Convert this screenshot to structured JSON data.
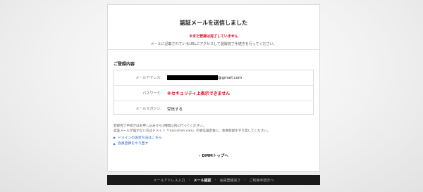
{
  "header": {
    "title": "認証メールを送信しました",
    "warning": "※まだ登録は完了していません",
    "description": "メールに記載されているURLにアクセスして登録完了手続きを行ってください。"
  },
  "registration": {
    "section_title": "ご登録内容",
    "rows": [
      {
        "label": "メールアドレス:",
        "value": "@gmail.com"
      },
      {
        "label": "パスワード:",
        "value": "※セキュリティ上表示できません"
      },
      {
        "label": "メールマガジン:",
        "value": "受信する"
      }
    ]
  },
  "notes": [
    "登録完了手続きはお申し込みから1時間以内に行ってください。",
    "認証メールが届かない方はドメイン「mail.dmm.com」の受信設定後に、会員登録をやり直してください。"
  ],
  "links": [
    "ドメインの設定方法はこちら",
    "会員登録をやり直す"
  ],
  "top_link": "DMMトップへ",
  "steps": [
    "メールアドレス入力",
    "メール認証",
    "会員登録完了",
    "ご利用手続きへ"
  ],
  "step_separator": "›",
  "colors": {
    "accent_red": "#e0001a",
    "link_blue": "#1f5fbf",
    "steps_bg": "#1a1a1a"
  }
}
